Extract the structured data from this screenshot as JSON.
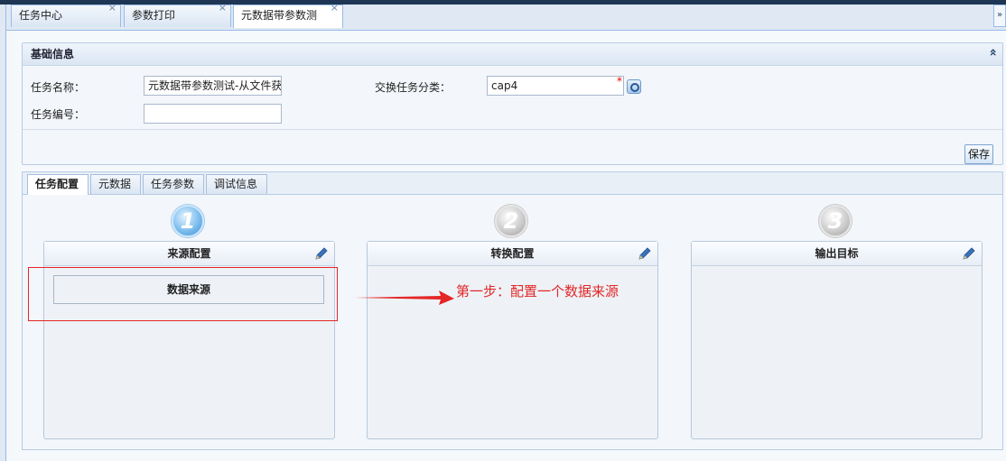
{
  "tabs": [
    {
      "label": "任务中心",
      "close": "×"
    },
    {
      "label": "参数打印",
      "close": "×"
    },
    {
      "label": "元数据带参数测",
      "close": "×"
    }
  ],
  "tab_scroll_icon": "»",
  "basic_panel": {
    "title": "基础信息",
    "collapse_icon": "«",
    "task_name_label": "任务名称：",
    "task_name_value": "元数据带参数测试-从文件获",
    "exchange_category_label": "交换任务分类：",
    "exchange_category_value": "cap4",
    "required_mark": "*",
    "task_number_label": "任务编号：",
    "task_number_value": "",
    "save_label": "保存"
  },
  "sub_tabs": [
    "任务配置",
    "元数据",
    "任务参数",
    "调试信息"
  ],
  "steps": [
    {
      "number": "1",
      "title": "来源配置",
      "active": true
    },
    {
      "number": "2",
      "title": "转换配置",
      "active": false
    },
    {
      "number": "3",
      "title": "输出目标",
      "active": false
    }
  ],
  "source_item": "数据来源",
  "annotation": "第一步：配置一个数据来源",
  "colors": {
    "accent": "#3f8fd3",
    "annotation": "#e32626",
    "border": "#99bbe8"
  },
  "icons": {
    "pencil": "pencil-icon",
    "lookup": "search-icon"
  }
}
